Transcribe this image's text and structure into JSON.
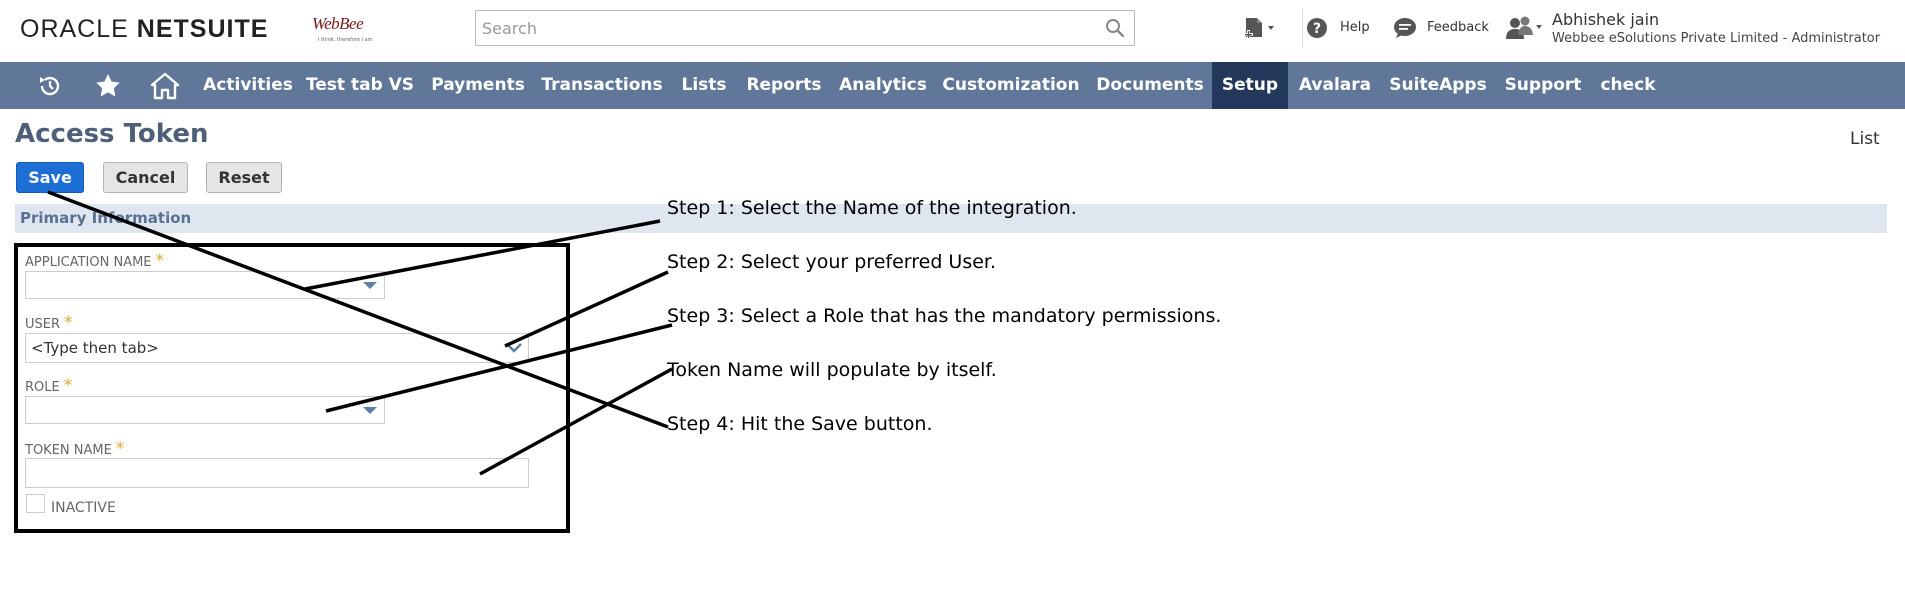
{
  "header": {
    "logo_oracle": "ORACLE",
    "logo_netsuite": "NETSUITE",
    "brand_name": "WebBee",
    "brand_tagline": "I think, therefore I am",
    "search_placeholder": "Search",
    "help_label": "Help",
    "feedback_label": "Feedback",
    "user_name": "Abhishek jain",
    "user_role": "Webbee eSolutions Private Limited - Administrator"
  },
  "nav": {
    "items": [
      {
        "label": "Activities"
      },
      {
        "label": "Test tab VS"
      },
      {
        "label": "Payments"
      },
      {
        "label": "Transactions"
      },
      {
        "label": "Lists"
      },
      {
        "label": "Reports"
      },
      {
        "label": "Analytics"
      },
      {
        "label": "Customization"
      },
      {
        "label": "Documents"
      },
      {
        "label": "Setup",
        "active": true
      },
      {
        "label": "Avalara"
      },
      {
        "label": "SuiteApps"
      },
      {
        "label": "Support"
      },
      {
        "label": "check"
      }
    ],
    "icons": [
      "recent-records-icon",
      "star-icon",
      "home-icon"
    ]
  },
  "page": {
    "title": "Access Token",
    "list_link": "List",
    "buttons": {
      "save": "Save",
      "cancel": "Cancel",
      "reset": "Reset"
    }
  },
  "form": {
    "section_title": "Primary Information",
    "application_name_label": "Application Name",
    "user_label": "User",
    "user_value": "<Type then tab>",
    "role_label": "Role",
    "token_name_label": "Token Name",
    "token_name_value": "",
    "inactive_label": "Inactive",
    "required_mark": "*"
  },
  "annotations": {
    "step1": "Step 1: Select the Name of the integration.",
    "step2": "Step 2: Select your preferred User.",
    "step3": "Step 3: Select a Role that has the mandatory permissions.",
    "token_note": "Token Name will populate by itself.",
    "step4": "Step 4: Hit the Save button."
  },
  "colors": {
    "navbar": "#607799",
    "nav_active": "#24385b",
    "primary_button": "#1d6fd6",
    "section_bar": "#e0e6ef",
    "title": "#4d5f79",
    "required": "#e0a630"
  }
}
